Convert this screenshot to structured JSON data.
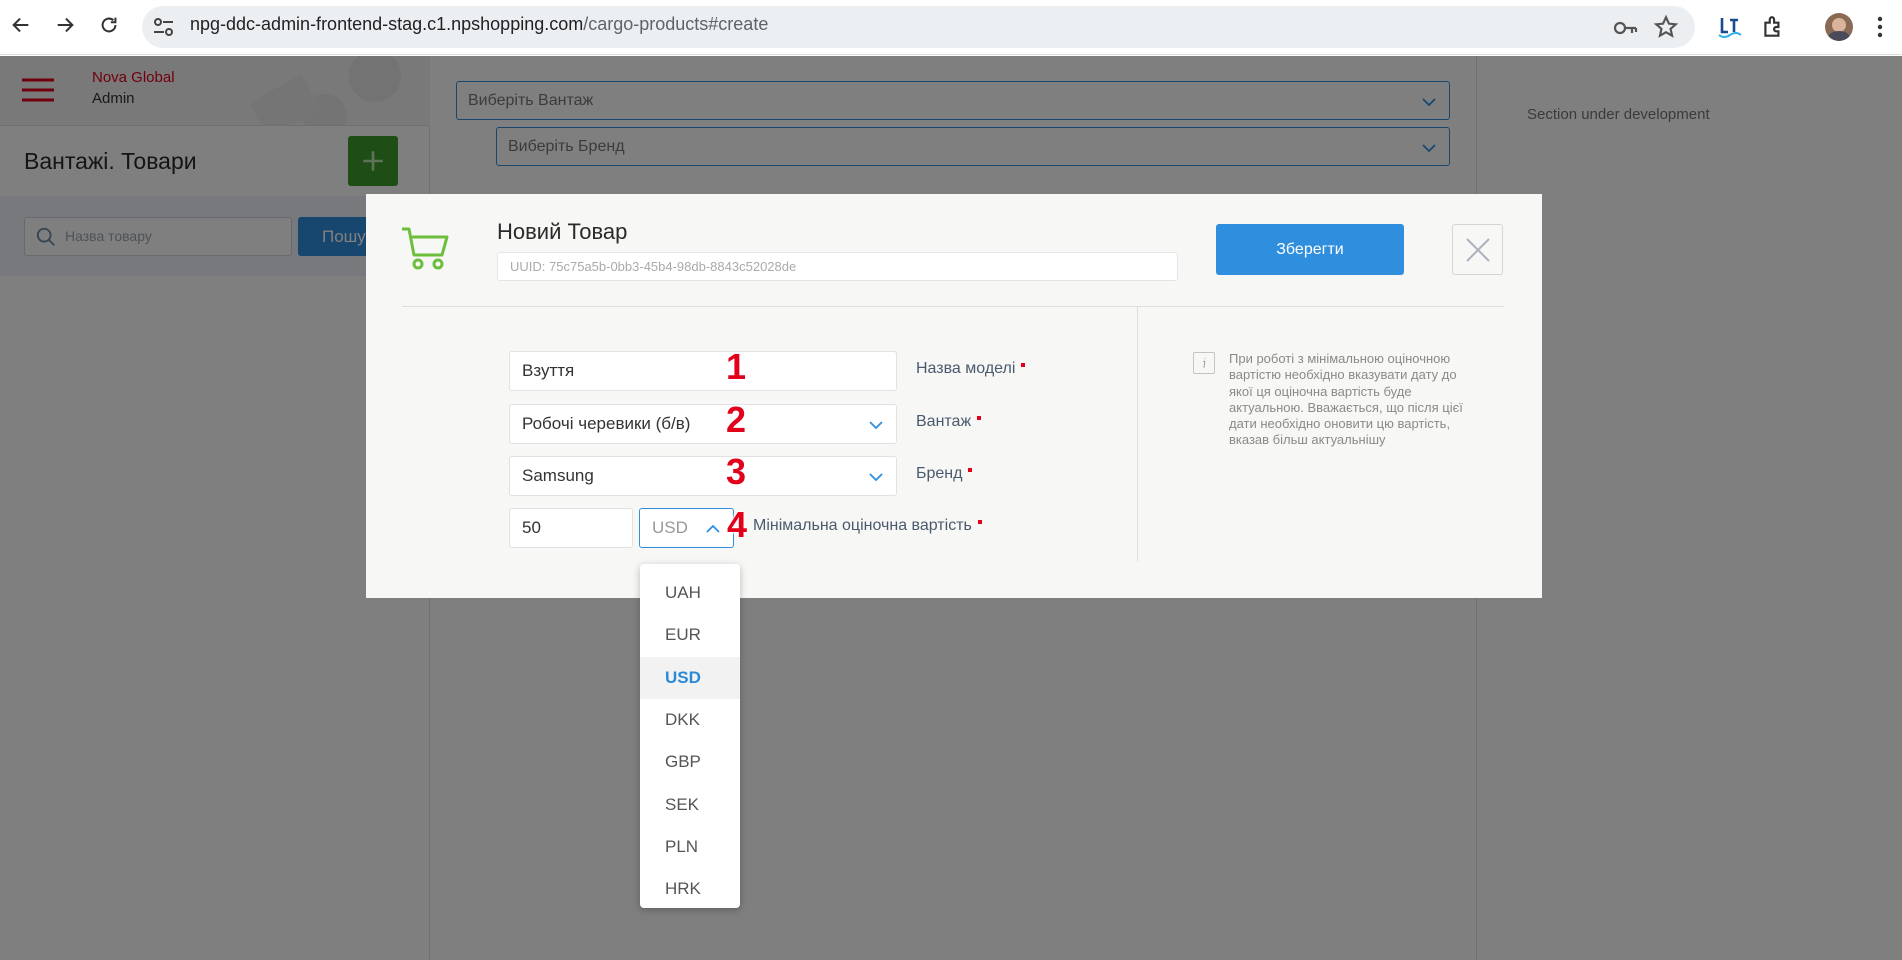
{
  "browser": {
    "url_host": "npg-ddc-admin-frontend-stag.c1.npshopping.com",
    "url_path": "/cargo-products#create"
  },
  "app": {
    "brand_line1": "Nova Global",
    "brand_line2": "Admin",
    "page_title": "Вантажі. Товари",
    "search_placeholder": "Назва товару",
    "search_button": "Пошук",
    "select_cargo_placeholder": "Виберіть Вантаж",
    "select_brand_placeholder": "Виберіть Бренд",
    "right_panel_text": "Section under development"
  },
  "modal": {
    "title": "Новий Товар",
    "uuid": "UUID: 75c75a5b-0bb3-45b4-98db-8843c52028de",
    "save_button": "Зберегти",
    "fields": {
      "model_name_value": "Взуття",
      "model_name_label": "Назва моделі",
      "cargo_value": "Робочі черевики (б/в)",
      "cargo_label": "Вантаж",
      "brand_value": "Samsung",
      "brand_label": "Бренд",
      "min_value": "50",
      "currency_value": "USD",
      "min_value_label": "Мінімальна оціночна вартість"
    },
    "info_text": "При роботі з мінімальною оціночною вартістю необхідно вказувати дату до якої ця оціночна вартість буде актуальною. Вважається, що після цієї дати необхідно оновити цю вартість, вказав більш актуальнішу",
    "annotations": [
      "1",
      "2",
      "3",
      "4"
    ]
  },
  "currency_options": [
    "UAH",
    "EUR",
    "USD",
    "DKK",
    "GBP",
    "SEK",
    "PLN",
    "HRK"
  ],
  "currency_selected": "USD",
  "colors": {
    "accent": "#2f8fde",
    "brand_red": "#e2001a",
    "add_green": "#3c9a2a",
    "cart_green": "#6cbf3c"
  }
}
